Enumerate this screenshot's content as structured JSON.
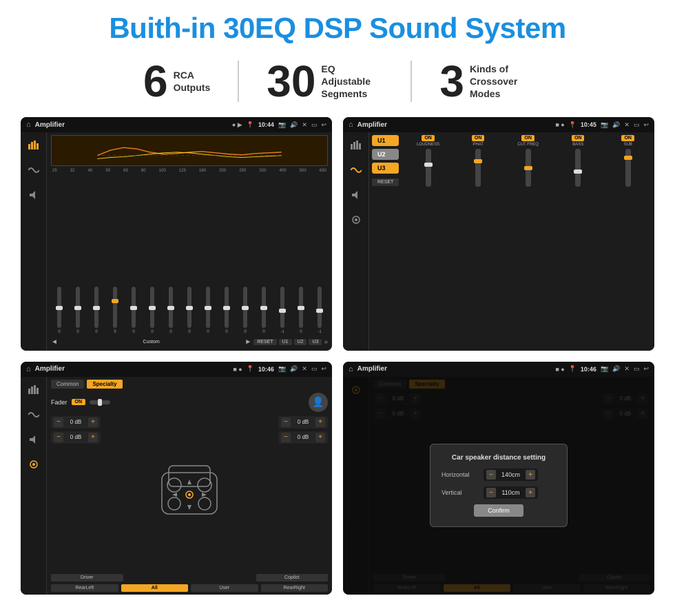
{
  "title": "Buith-in 30EQ DSP Sound System",
  "stats": [
    {
      "number": "6",
      "label": "RCA\nOutputs"
    },
    {
      "number": "30",
      "label": "EQ Adjustable\nSegments"
    },
    {
      "number": "3",
      "label": "Kinds of\nCrossover Modes"
    }
  ],
  "screens": [
    {
      "id": "eq-screen",
      "time": "10:44",
      "appTitle": "Amplifier",
      "freqs": [
        "25",
        "32",
        "40",
        "50",
        "63",
        "80",
        "100",
        "125",
        "160",
        "200",
        "250",
        "320",
        "400",
        "500",
        "630"
      ],
      "sliderValues": [
        "0",
        "0",
        "0",
        "5",
        "0",
        "0",
        "0",
        "0",
        "0",
        "0",
        "0",
        "0",
        "-1",
        "0",
        "-1"
      ],
      "bottomBtns": [
        "Custom",
        "RESET",
        "U1",
        "U2",
        "U3"
      ]
    },
    {
      "id": "crossover-screen",
      "time": "10:45",
      "appTitle": "Amplifier",
      "uButtons": [
        "U1",
        "U2",
        "U3"
      ],
      "channels": [
        {
          "on": true,
          "label": "LOUDNESS"
        },
        {
          "on": true,
          "label": "PHAT"
        },
        {
          "on": true,
          "label": "CUT FREQ"
        },
        {
          "on": true,
          "label": "BASS"
        },
        {
          "on": true,
          "label": "SUB"
        }
      ],
      "resetBtn": "RESET"
    },
    {
      "id": "fader-screen",
      "time": "10:46",
      "appTitle": "Amplifier",
      "tabs": [
        "Common",
        "Specialty"
      ],
      "activeTab": "Specialty",
      "faderLabel": "Fader",
      "faderOn": "ON",
      "volumes": [
        "0 dB",
        "0 dB",
        "0 dB",
        "0 dB"
      ],
      "bottomBtns": [
        "Driver",
        "",
        "Copilot",
        "RearLeft",
        "All",
        "User",
        "RearRight"
      ]
    },
    {
      "id": "dialog-screen",
      "time": "10:46",
      "appTitle": "Amplifier",
      "dialogTitle": "Car speaker distance setting",
      "dialogRows": [
        {
          "label": "Horizontal",
          "value": "140cm"
        },
        {
          "label": "Vertical",
          "value": "110cm"
        }
      ],
      "confirmLabel": "Confirm",
      "volumes": [
        "0 dB",
        "0 dB"
      ],
      "bottomBtns": [
        "Driver",
        "Copilot",
        "RearLeft",
        "All",
        "User",
        "RearRight"
      ]
    }
  ]
}
